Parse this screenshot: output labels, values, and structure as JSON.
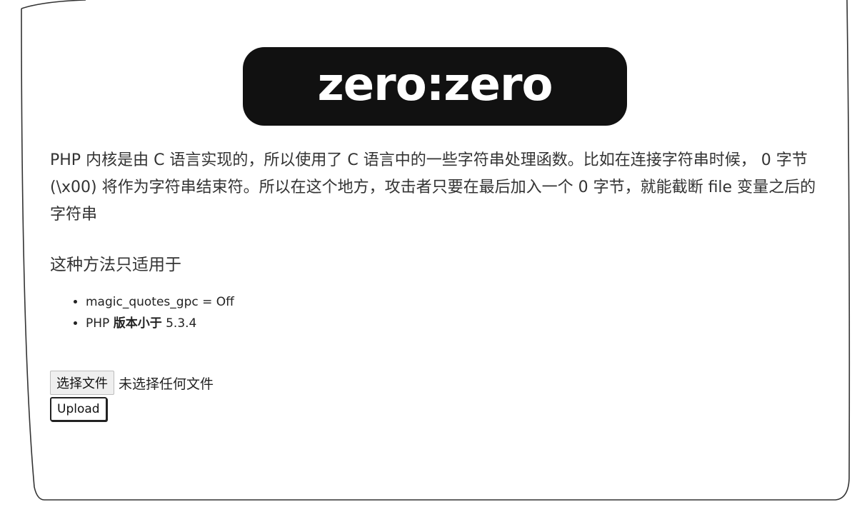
{
  "logo": {
    "text": "zero:zero"
  },
  "intro": {
    "text": "PHP 内核是由 C 语言实现的，所以使用了 C 语言中的一些字符串处理函数。比如在连接字符串时候， 0 字节 (\\x00) 将作为字符串结束符。所以在这个地方，攻击者只要在最后加入一个 0 字节，就能截断 file 变量之后的字符串"
  },
  "subheading": "这种方法只适用于",
  "conditions": [
    {
      "text": "magic_quotes_gpc = Off"
    },
    {
      "prefix": "PHP ",
      "bold": "版本小于",
      "suffix": " 5.3.4"
    }
  ],
  "upload_form": {
    "choose_file_label": "选择文件",
    "no_file_status": "未选择任何文件",
    "upload_label": "Upload"
  },
  "colors": {
    "logo_background": "#111111",
    "logo_text": "#ffffff",
    "text": "#333333"
  }
}
